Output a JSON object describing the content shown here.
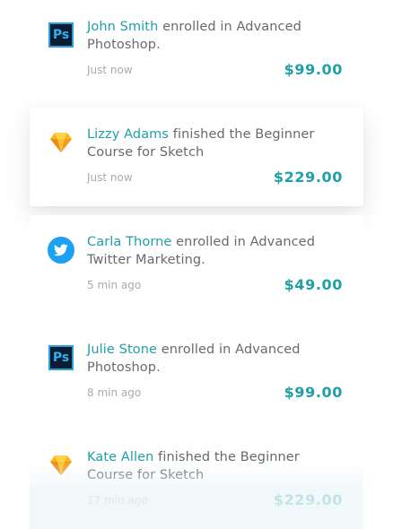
{
  "feed": {
    "items": [
      {
        "icon": "photoshop-icon",
        "icon_text": "Ps",
        "name": "John Smith",
        "action": " enrolled in Advanced Photoshop.",
        "time": "Just now",
        "price": "$99.00"
      },
      {
        "icon": "sketch-icon",
        "name": "Lizzy Adams",
        "action": " finished the Beginner Course for Sketch",
        "time": "Just now",
        "price": "$229.00"
      },
      {
        "icon": "twitter-icon",
        "name": "Carla Thorne",
        "action": " enrolled in Advanced Twitter Marketing.",
        "time": "5 min ago",
        "price": "$49.00"
      },
      {
        "icon": "photoshop-icon",
        "icon_text": "Ps",
        "name": "Julie Stone",
        "action": " enrolled in Advanced Photoshop.",
        "time": "8 min ago",
        "price": "$99.00"
      },
      {
        "icon": "sketch-icon",
        "name": "Kate Allen",
        "action": " finished the Beginner Course for Sketch",
        "time": "17 min ago",
        "price": "$229.00"
      }
    ],
    "colors": {
      "accent": "#1f9fa6",
      "text": "#666a6e",
      "muted": "#a7abaf",
      "twitter": "#1da1f2",
      "sketch": "#f7b61a",
      "photoshop_bg": "#0b1d33",
      "photoshop_border": "#2a9fdc"
    }
  }
}
